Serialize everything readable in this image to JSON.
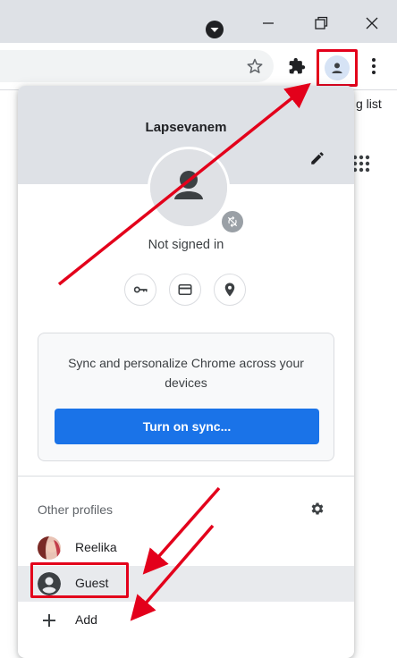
{
  "window": {
    "controls": [
      "minimize-icon",
      "restore-icon",
      "close-icon"
    ]
  },
  "toolbar": {
    "icons": [
      "bookmark-star-icon",
      "extensions-icon",
      "profile-icon",
      "menu-icon"
    ]
  },
  "background_page": {
    "partial_text": "g list"
  },
  "profile_menu": {
    "profile_name": "Lapsevanem",
    "status": "Not signed in",
    "quick_actions": [
      "passwords-key-icon",
      "payment-card-icon",
      "addresses-pin-icon"
    ],
    "sync_card": {
      "text": "Sync and personalize Chrome across your devices",
      "button_label": "Turn on sync..."
    },
    "other_profiles_label": "Other profiles",
    "profiles": [
      {
        "label": "Reelika"
      },
      {
        "label": "Guest"
      }
    ],
    "add_label": "Add"
  },
  "colors": {
    "accent": "#1a73e8",
    "highlight": "#e3001b",
    "header_bg": "#dee1e6"
  }
}
